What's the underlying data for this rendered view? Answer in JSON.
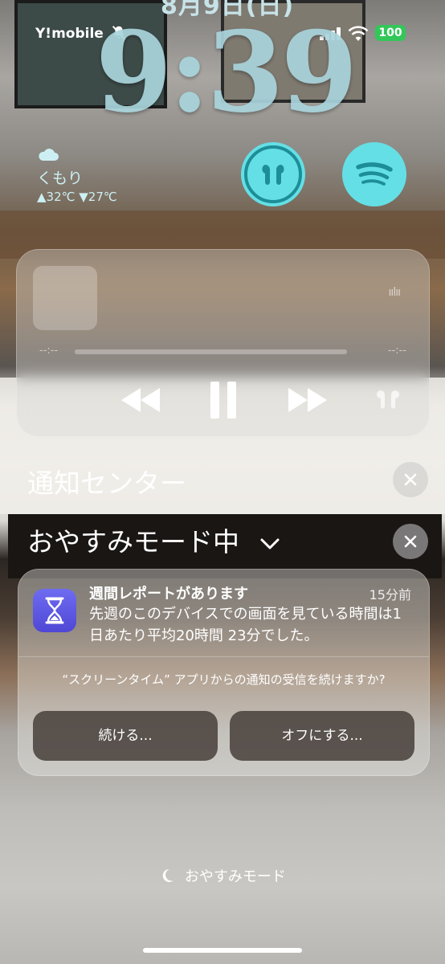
{
  "status_bar": {
    "date": "8月9日(日)",
    "carrier": "Y!mobile",
    "battery": "100"
  },
  "clock": "9:39",
  "weather": {
    "condition": "くもり",
    "temps": "▲32℃ ▼27℃"
  },
  "widgets": [
    "airpods-icon",
    "spotify-icon"
  ],
  "player": {
    "elapsed": "--:--",
    "remaining": "--:--",
    "controls": [
      "rewind-icon",
      "pause-icon",
      "fast-forward-icon",
      "airpods-output-icon"
    ]
  },
  "notification_center": {
    "title": "通知センター",
    "focus_mode": "おやすみモード中"
  },
  "notification": {
    "app_icon": "hourglass-icon",
    "title": "週間レポートがあります",
    "time": "15分前",
    "body": "先週のこのデバイスでの画面を見ている時間は1日あたり平均20時間 23分でした。",
    "question": "“スクリーンタイム” アプリからの通知の受信を続けますか?",
    "continue_label": "続ける...",
    "off_label": "オフにする..."
  },
  "footer": {
    "dnd_label": "おやすみモード"
  },
  "colors": {
    "clock": "#a9d4dc",
    "widget": "#65dfe6",
    "battery": "#32c759",
    "app_icon": "#5a52e0"
  }
}
